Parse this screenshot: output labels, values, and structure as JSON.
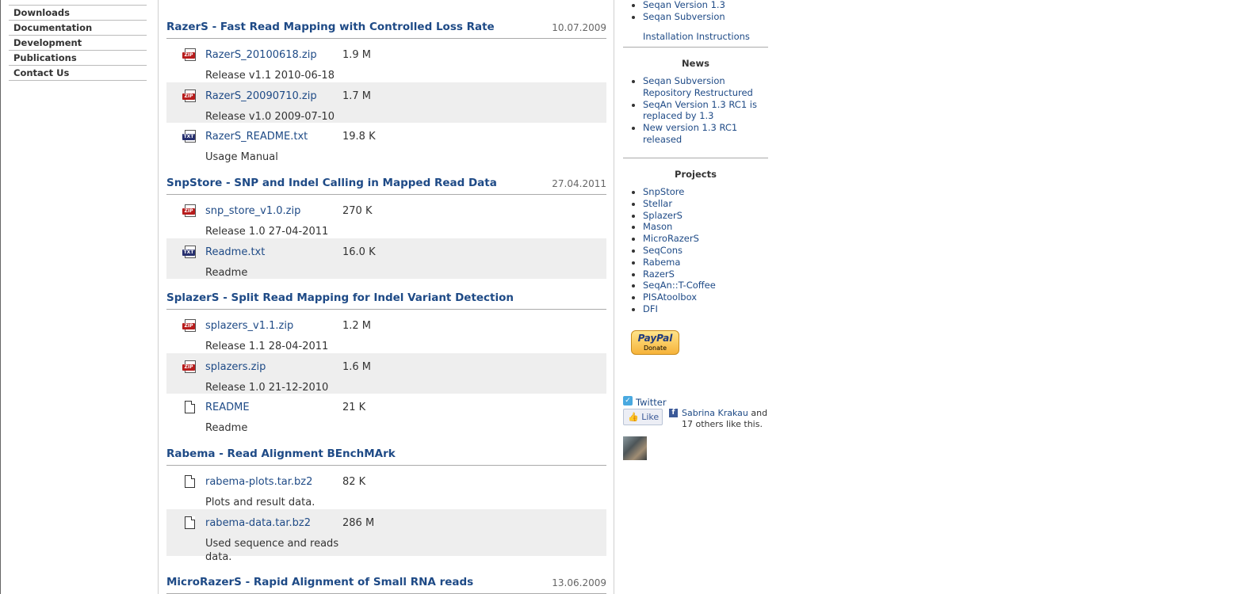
{
  "leftnav": {
    "items": [
      "Downloads",
      "Documentation",
      "Development",
      "Publications",
      "Contact Us"
    ]
  },
  "main": {
    "sections": [
      {
        "title": "RazerS - Fast Read Mapping with Controlled Loss Rate",
        "date": "10.07.2009",
        "files": [
          {
            "icon": "zip-file-icon",
            "name": "RazerS_20100618.zip",
            "size": "1.9 M",
            "desc": "Release v1.1 2010-06-18"
          },
          {
            "icon": "zip-file-icon",
            "name": "RazerS_20090710.zip",
            "size": "1.7 M",
            "desc": "Release v1.0 2009-07-10"
          },
          {
            "icon": "txt-file-icon",
            "name": "RazerS_README.txt",
            "size": "19.8 K",
            "desc": "Usage Manual"
          }
        ]
      },
      {
        "title": "SnpStore - SNP and Indel Calling in Mapped Read Data",
        "date": "27.04.2011",
        "files": [
          {
            "icon": "zip-file-icon",
            "name": "snp_store_v1.0.zip",
            "size": "270 K",
            "desc": "Release 1.0 27-04-2011"
          },
          {
            "icon": "txt-file-icon",
            "name": "Readme.txt",
            "size": "16.0 K",
            "desc": "Readme"
          }
        ]
      },
      {
        "title": "SplazerS - Split Read Mapping for Indel Variant Detection",
        "date": "",
        "files": [
          {
            "icon": "zip-file-icon",
            "name": "splazers_v1.1.zip",
            "size": "1.2 M",
            "desc": "Release 1.1 28-04-2011"
          },
          {
            "icon": "zip-file-icon",
            "name": "splazers.zip",
            "size": "1.6 M",
            "desc": "Release 1.0 21-12-2010"
          },
          {
            "icon": "generic-file-icon",
            "name": "README",
            "size": "21 K",
            "desc": "Readme"
          }
        ]
      },
      {
        "title": "Rabema - Read Alignment BEnchMArk",
        "date": "",
        "files": [
          {
            "icon": "generic-file-icon",
            "name": "rabema-plots.tar.bz2",
            "size": "82 K",
            "desc": "Plots and result data."
          },
          {
            "icon": "generic-file-icon",
            "name": "rabema-data.tar.bz2",
            "size": "286 M",
            "desc": "Used sequence and reads data."
          }
        ]
      },
      {
        "title": "MicroRazerS - Rapid Alignment of Small RNA reads",
        "date": "13.06.2009",
        "files": []
      }
    ]
  },
  "sidebar": {
    "top_links": [
      "Seqan Version 1.3",
      "Seqan Subversion"
    ],
    "install_link": "Installation Instructions",
    "news_heading": "News",
    "news": [
      "Seqan Subversion Repository Restructured",
      "SeqAn Version 1.3 RC1 is replaced by 1.3",
      "New version 1.3 RC1 released"
    ],
    "projects_heading": "Projects",
    "projects": [
      "SnpStore",
      "Stellar",
      "SplazerS",
      "Mason",
      "MicroRazerS",
      "SeqCons",
      "Rabema",
      "RazerS",
      "SeqAn::T-Coffee",
      "PISAtoolbox",
      "DFI"
    ],
    "paypal": {
      "brand": "PayPal",
      "label": "Donate"
    },
    "twitter": "Twitter",
    "like_label": "Like",
    "fb_name": "Sabrina Krakau",
    "fb_and": " and",
    "fb_rest": "17 others like this."
  }
}
